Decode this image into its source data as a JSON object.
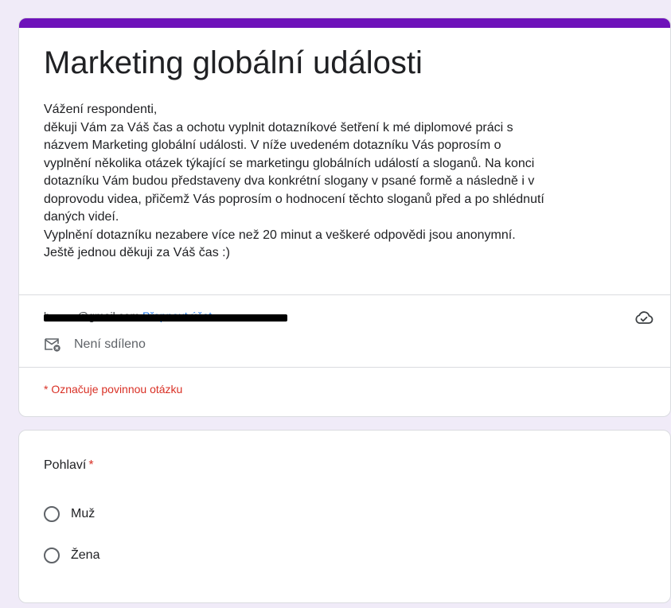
{
  "form": {
    "title": "Marketing globální události",
    "description_lines": [
      "Vážení respondenti,",
      "děkuji Vám za Váš čas a ochotu vyplnit dotazníkové šetření k mé diplomové práci s",
      "názvem Marketing globální události. V níže uvedeném dotazníku Vás poprosím o",
      "vyplnění několika otázek týkající se marketingu globálních událostí a sloganů. Na konci",
      "dotazníku Vám budou představeny dva konkrétní slogany v psané formě a následně i v",
      "doprovodu videa, přičemž Vás poprosím o hodnocení těchto sloganů před a po shlédnutí",
      "daných videí.",
      "Vyplnění dotazníku nezabere více než 20 minut a veškeré odpovědi jsou anonymní.",
      "Ještě jednou děkuji za Váš čas :)"
    ],
    "account": {
      "email": "b•••••••@gmail.com",
      "switch_label": "Přepnout účet",
      "not_shared": "Není sdíleno"
    },
    "required_note": "* Označuje povinnou otázku",
    "accent_color": "#6e12ba"
  },
  "question": {
    "label": "Pohlaví",
    "required_mark": "*",
    "options": [
      "Muž",
      "Žena"
    ]
  },
  "icons": {
    "cloud": "cloud-saved-icon",
    "mail": "mail-not-shared-icon",
    "radio": "radio-unchecked-icon"
  }
}
